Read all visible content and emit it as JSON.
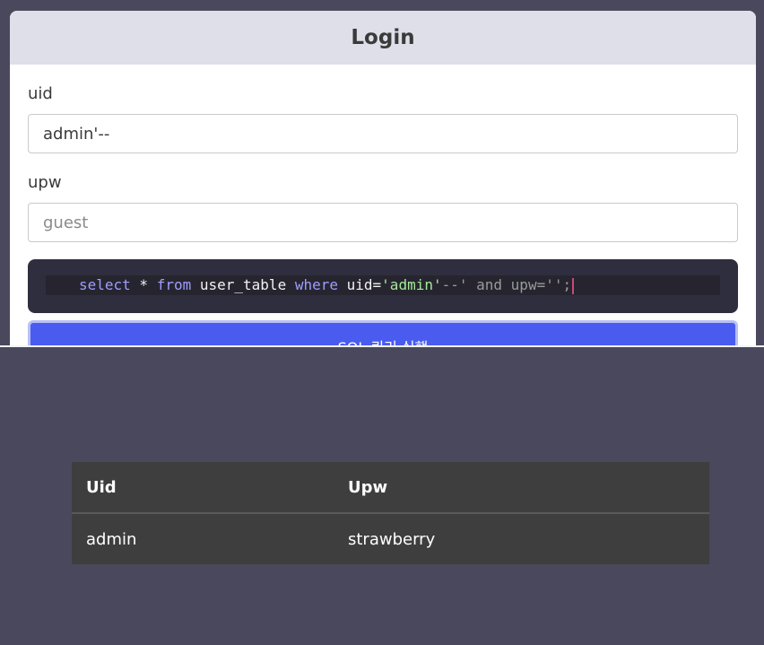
{
  "login": {
    "title": "Login",
    "uid_label": "uid",
    "uid_value": "admin'--",
    "upw_label": "upw",
    "upw_placeholder": "guest",
    "run_button_label": "SQL 쿼리 실행"
  },
  "query": {
    "t1": "select",
    "t2": " * ",
    "t3": "from",
    "t4": " user_table ",
    "t5": "where",
    "t6": " uid=",
    "t7": "'admin'",
    "t8": "--' and upw='';"
  },
  "results": {
    "headers": [
      "Uid",
      "Upw"
    ],
    "rows": [
      [
        "admin",
        "strawberry"
      ]
    ]
  },
  "colors": {
    "accent": "#4a5cf0",
    "background": "#4a485c",
    "table_bg": "#3e3e3e"
  }
}
